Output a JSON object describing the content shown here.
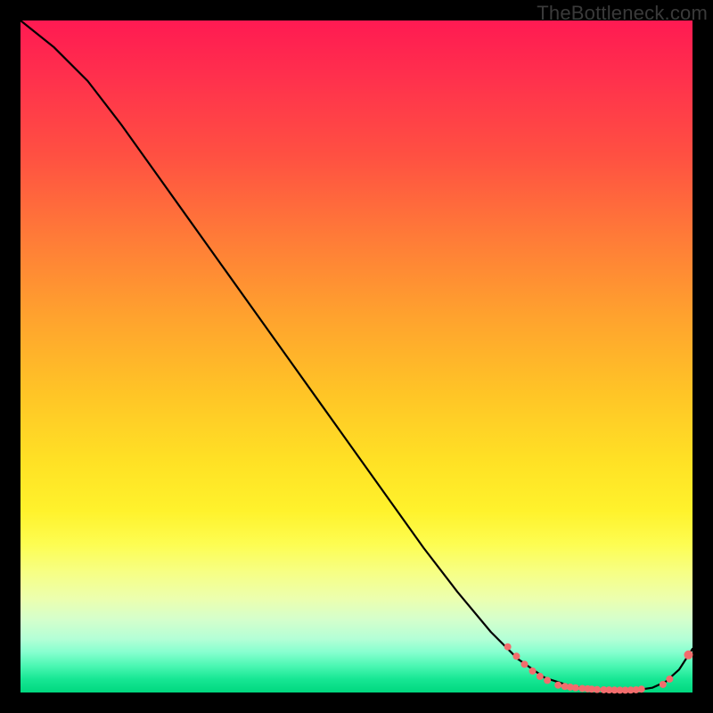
{
  "watermark": "TheBottleneck.com",
  "chart_data": {
    "type": "line",
    "title": "",
    "xlabel": "",
    "ylabel": "",
    "xlim": [
      0,
      100
    ],
    "ylim": [
      0,
      100
    ],
    "grid": false,
    "legend": false,
    "series": [
      {
        "name": "curve",
        "color": "#000000",
        "x": [
          0,
          5,
          10,
          15,
          20,
          25,
          30,
          35,
          40,
          45,
          50,
          55,
          60,
          65,
          70,
          74,
          78,
          82,
          86,
          88,
          90,
          92,
          94,
          96,
          98,
          100
        ],
        "y": [
          100,
          96,
          91,
          84.5,
          77.5,
          70.5,
          63.5,
          56.5,
          49.5,
          42.5,
          35.5,
          28.5,
          21.5,
          15,
          9,
          5,
          2.2,
          0.9,
          0.4,
          0.3,
          0.3,
          0.4,
          0.7,
          1.6,
          3.4,
          6.5
        ]
      },
      {
        "name": "markers",
        "type": "scatter",
        "color": "#f26d6d",
        "points": [
          {
            "x": 72.5,
            "y": 6.8,
            "r": 4
          },
          {
            "x": 73.8,
            "y": 5.4,
            "r": 4
          },
          {
            "x": 75.0,
            "y": 4.2,
            "r": 4
          },
          {
            "x": 76.2,
            "y": 3.2,
            "r": 4
          },
          {
            "x": 77.3,
            "y": 2.4,
            "r": 4
          },
          {
            "x": 78.4,
            "y": 1.8,
            "r": 4
          },
          {
            "x": 80.0,
            "y": 1.1,
            "r": 4
          },
          {
            "x": 81.0,
            "y": 0.9,
            "r": 4
          },
          {
            "x": 81.8,
            "y": 0.8,
            "r": 4
          },
          {
            "x": 82.6,
            "y": 0.7,
            "r": 4
          },
          {
            "x": 83.6,
            "y": 0.6,
            "r": 4
          },
          {
            "x": 84.4,
            "y": 0.55,
            "r": 4
          },
          {
            "x": 85.0,
            "y": 0.5,
            "r": 4
          },
          {
            "x": 85.8,
            "y": 0.45,
            "r": 4
          },
          {
            "x": 86.8,
            "y": 0.4,
            "r": 4
          },
          {
            "x": 87.6,
            "y": 0.38,
            "r": 4
          },
          {
            "x": 88.4,
            "y": 0.36,
            "r": 4
          },
          {
            "x": 89.2,
            "y": 0.35,
            "r": 4
          },
          {
            "x": 90.0,
            "y": 0.35,
            "r": 4
          },
          {
            "x": 90.8,
            "y": 0.36,
            "r": 4
          },
          {
            "x": 91.6,
            "y": 0.4,
            "r": 4
          },
          {
            "x": 92.4,
            "y": 0.5,
            "r": 4
          },
          {
            "x": 95.6,
            "y": 1.2,
            "r": 4
          },
          {
            "x": 96.6,
            "y": 2.0,
            "r": 4
          },
          {
            "x": 99.4,
            "y": 5.6,
            "r": 5
          }
        ]
      }
    ]
  }
}
